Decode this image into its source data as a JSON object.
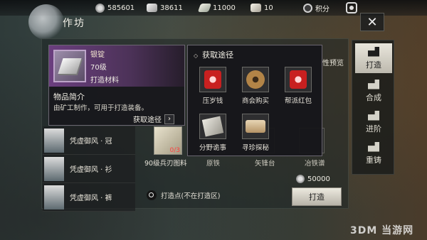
{
  "resources": [
    {
      "icon": "coin-icon",
      "value": "585601"
    },
    {
      "icon": "silver-icon",
      "value": "38611"
    },
    {
      "icon": "scroll-icon",
      "value": "11000"
    },
    {
      "icon": "ticket-icon",
      "value": "10"
    },
    {
      "icon": "badge-icon",
      "value": "积分"
    }
  ],
  "window": {
    "title": "作坊",
    "close": "✕"
  },
  "tabs": [
    {
      "label": "打造",
      "active": true
    },
    {
      "label": "合成",
      "active": false
    },
    {
      "label": "进阶",
      "active": false
    },
    {
      "label": "重铸",
      "active": false
    }
  ],
  "item": {
    "name": "银锭",
    "level": "70级",
    "type": "打造材料",
    "desc_title": "物品简介",
    "desc": "由矿工制作，可用于打造装备。",
    "get_label": "获取途径",
    "arrow": "›"
  },
  "sources": {
    "title": "获取途径",
    "items": [
      {
        "label": "压岁钱",
        "icon": "redpack-icon"
      },
      {
        "label": "商会购买",
        "icon": "coin-icon"
      },
      {
        "label": "帮派红包",
        "icon": "redpack-icon"
      },
      {
        "label": "分野诡事",
        "icon": "cards-icon"
      },
      {
        "label": "寻珍探秘",
        "icon": "treasure-icon"
      }
    ]
  },
  "list": [
    {
      "name": "凭虚御风 · 冠"
    },
    {
      "name": "凭虚御风 · 衫"
    },
    {
      "name": "凭虚御风 · 裤"
    }
  ],
  "book": {
    "label": "90级兵刃图料",
    "count": "0/3"
  },
  "partial_labels": [
    "原铁",
    "矢锋台",
    "冶铁谱"
  ],
  "preview": "性预览",
  "cost": {
    "value": "50000"
  },
  "forge_button": "打造",
  "forge_point": "打造点(不在打造区)",
  "watermark": "3DM 当游网"
}
